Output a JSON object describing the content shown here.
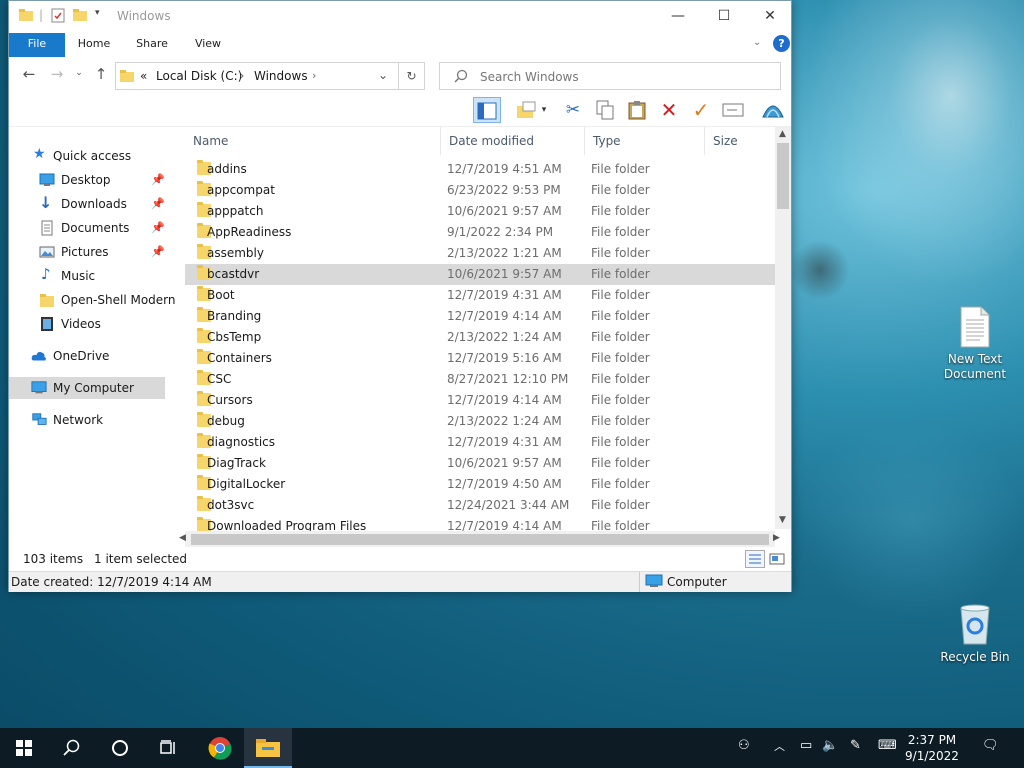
{
  "window": {
    "title": "Windows",
    "controls": {
      "minimize": "—",
      "maximize": "☐",
      "close": "✕"
    }
  },
  "ribbon": {
    "tabs": [
      {
        "label": "File"
      },
      {
        "label": "Home"
      },
      {
        "label": "Share"
      },
      {
        "label": "View"
      }
    ],
    "help": "?"
  },
  "address": {
    "overflow": "«",
    "crumbs": [
      "Local Disk (C:)",
      "Windows"
    ],
    "search_placeholder": "Search Windows"
  },
  "nav": {
    "quick_access": "Quick access",
    "items": [
      {
        "label": "Desktop",
        "pinned": true
      },
      {
        "label": "Downloads",
        "pinned": true
      },
      {
        "label": "Documents",
        "pinned": true
      },
      {
        "label": "Pictures",
        "pinned": true
      },
      {
        "label": "Music",
        "pinned": false
      },
      {
        "label": "Open-Shell Modern",
        "pinned": false
      },
      {
        "label": "Videos",
        "pinned": false
      }
    ],
    "onedrive": "OneDrive",
    "my_computer": "My Computer",
    "network": "Network"
  },
  "columns": {
    "name": "Name",
    "date": "Date modified",
    "type": "Type",
    "size": "Size"
  },
  "files": [
    {
      "name": "addins",
      "date": "12/7/2019 4:51 AM",
      "type": "File folder"
    },
    {
      "name": "appcompat",
      "date": "6/23/2022 9:53 PM",
      "type": "File folder"
    },
    {
      "name": "apppatch",
      "date": "10/6/2021 9:57 AM",
      "type": "File folder"
    },
    {
      "name": "AppReadiness",
      "date": "9/1/2022 2:34 PM",
      "type": "File folder"
    },
    {
      "name": "assembly",
      "date": "2/13/2022 1:21 AM",
      "type": "File folder"
    },
    {
      "name": "bcastdvr",
      "date": "10/6/2021 9:57 AM",
      "type": "File folder",
      "selected": true
    },
    {
      "name": "Boot",
      "date": "12/7/2019 4:31 AM",
      "type": "File folder"
    },
    {
      "name": "Branding",
      "date": "12/7/2019 4:14 AM",
      "type": "File folder"
    },
    {
      "name": "CbsTemp",
      "date": "2/13/2022 1:24 AM",
      "type": "File folder"
    },
    {
      "name": "Containers",
      "date": "12/7/2019 5:16 AM",
      "type": "File folder"
    },
    {
      "name": "CSC",
      "date": "8/27/2021 12:10 PM",
      "type": "File folder"
    },
    {
      "name": "Cursors",
      "date": "12/7/2019 4:14 AM",
      "type": "File folder"
    },
    {
      "name": "debug",
      "date": "2/13/2022 1:24 AM",
      "type": "File folder"
    },
    {
      "name": "diagnostics",
      "date": "12/7/2019 4:31 AM",
      "type": "File folder"
    },
    {
      "name": "DiagTrack",
      "date": "10/6/2021 9:57 AM",
      "type": "File folder"
    },
    {
      "name": "DigitalLocker",
      "date": "12/7/2019 4:50 AM",
      "type": "File folder"
    },
    {
      "name": "dot3svc",
      "date": "12/24/2021 3:44 AM",
      "type": "File folder"
    },
    {
      "name": "Downloaded Program Files",
      "date": "12/7/2019 4:14 AM",
      "type": "File folder"
    }
  ],
  "status": {
    "items_count": "103 items",
    "selected": "1 item selected",
    "date_created": "Date created: 12/7/2019 4:14 AM",
    "location": "Computer"
  },
  "desktop": {
    "icons": [
      {
        "label_line1": "New Text",
        "label_line2": "Document"
      },
      {
        "label_line1": "Recycle Bin",
        "label_line2": ""
      }
    ]
  },
  "taskbar": {
    "time": "2:37 PM",
    "date": "9/1/2022"
  },
  "colors": {
    "file_tab": "#1979ca",
    "selection": "#d9d9d9",
    "folder": "#f6d56a",
    "taskbar": "#0d1b24"
  }
}
